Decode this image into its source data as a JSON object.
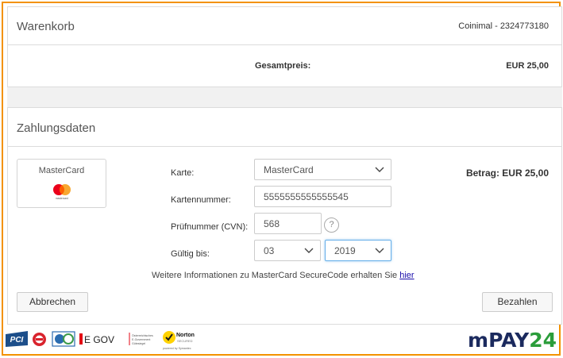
{
  "cart": {
    "title": "Warenkorb",
    "merchant": "Coinimal - 2324773180",
    "total_label": "Gesamtpreis:",
    "total_value": "EUR 25,00"
  },
  "payment": {
    "title": "Zahlungsdaten",
    "brand_name": "MasterCard",
    "brand_logo_text": "mastercard",
    "amount": "Betrag: EUR 25,00",
    "card_label": "Karte:",
    "card_value": "MasterCard",
    "number_label": "Kartennummer:",
    "number_value": "5555555555555545",
    "cvn_label": "Prüfnummer (CVN):",
    "cvn_value": "568",
    "cvn_help": "?",
    "valid_label": "Gültig bis:",
    "month_value": "03",
    "year_value": "2019",
    "info_text": "Weitere Informationen zu MasterCard SecureCode erhalten Sie",
    "info_link": "hier"
  },
  "buttons": {
    "cancel": "Abbrechen",
    "submit": "Bezahlen"
  },
  "footer": {
    "pci": "PCI",
    "gov": "E GOV",
    "norton": "Norton",
    "norton_sub": "SECURED",
    "norton_by": "powered by Symantec",
    "egov_small": "Österreichisches E-Government Gütesiegel",
    "brand": {
      "m": "m",
      "pay": "PAY",
      "num": "24"
    }
  },
  "colors": {
    "frame": "#f39200",
    "focus": "#66afe9",
    "link": "#1a0dab",
    "mpay_blue": "#1b2a5e",
    "mpay_green": "#2a9d3a"
  }
}
